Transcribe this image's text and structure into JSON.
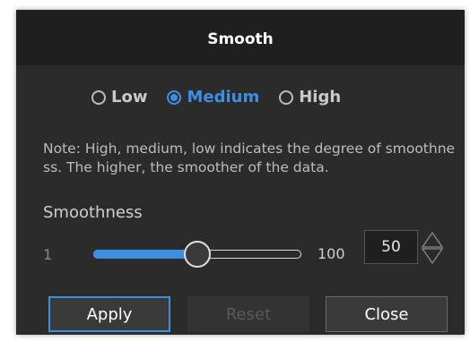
{
  "dialog": {
    "title": "Smooth"
  },
  "levels": {
    "options": [
      {
        "label": "Low",
        "checked": false
      },
      {
        "label": "Medium",
        "checked": true
      },
      {
        "label": "High",
        "checked": false
      }
    ]
  },
  "note": "Note: High, medium, low indicates the degree of smoothness. The higher, the smoother of the data.",
  "smoothness": {
    "label": "Smoothness",
    "min_label": "1",
    "max_label": "100",
    "value": "50",
    "value_fraction": 0.5
  },
  "buttons": {
    "apply": "Apply",
    "reset": "Reset",
    "close": "Close"
  },
  "colors": {
    "accent": "#3d8fe0",
    "dialog_bg": "#2b2b2b",
    "titlebar_bg": "#1f1f1f"
  },
  "icons": {
    "spin_up": "chevron-up-icon",
    "spin_down": "chevron-down-icon"
  }
}
